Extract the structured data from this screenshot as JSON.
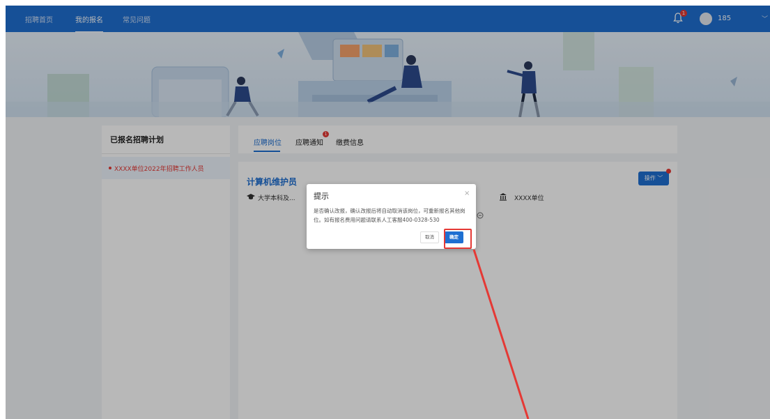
{
  "nav": {
    "items": [
      {
        "label": "招聘首页"
      },
      {
        "label": "我的报名"
      },
      {
        "label": "常见问题"
      }
    ],
    "bell_badge": "1",
    "user_name": "185",
    "caret": "﹀"
  },
  "left_panel": {
    "title": "已报名招聘计划",
    "items": [
      {
        "label": "XXXX单位2022年招聘工作人员"
      }
    ]
  },
  "tabs": [
    {
      "label": "应聘岗位"
    },
    {
      "label": "应聘通知",
      "badge": "1"
    },
    {
      "label": "缴费信息"
    }
  ],
  "job": {
    "title": "计算机维护员",
    "education": "大学本科及...",
    "org": "XXXX单位",
    "op_button": "操作 ﹀"
  },
  "dialog": {
    "title": "提示",
    "close": "×",
    "message": "是否确认改报，确认改报后将自动取消该岗位，可重新报名其他岗位。如有报名费用问题请联系人工客服400-0328-530",
    "cancel": "取消",
    "ok": "确定"
  },
  "colors": {
    "brand": "#1f6fd1",
    "alert": "#e53935",
    "annotation": "#e53935"
  }
}
